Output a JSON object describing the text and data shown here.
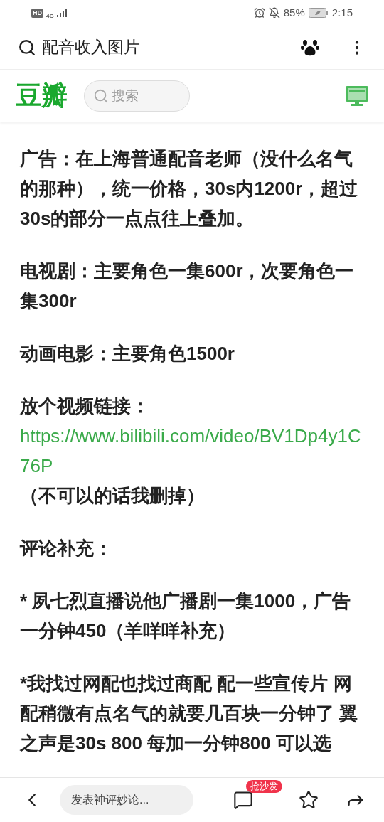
{
  "status_bar": {
    "hd": "HD",
    "network": "4G",
    "battery": "85%",
    "time": "2:15"
  },
  "browser_bar": {
    "query": "配音收入图片"
  },
  "site_header": {
    "logo": "豆瓣",
    "search_placeholder": "搜索"
  },
  "paragraphs": [
    {
      "segments": [
        {
          "kind": "text",
          "text": "广告：在上海普通配音老师（没什么名气的那种），统一价格，30s内1200r，超过30s的部分一点点往上叠加。"
        }
      ]
    },
    {
      "segments": [
        {
          "kind": "text",
          "text": "电视剧：主要角色一集600r，次要角色一集300r"
        }
      ]
    },
    {
      "segments": [
        {
          "kind": "text",
          "text": "动画电影：主要角色1500r"
        }
      ]
    },
    {
      "segments": [
        {
          "kind": "text",
          "text": "放个视频链接："
        },
        {
          "kind": "break"
        },
        {
          "kind": "link",
          "text": "https://www.bilibili.com/video/BV1Dp4y1C76P"
        },
        {
          "kind": "text",
          "text": " （不可以的话我删掉）"
        }
      ]
    },
    {
      "segments": [
        {
          "kind": "text",
          "text": "评论补充："
        }
      ]
    },
    {
      "segments": [
        {
          "kind": "text",
          "text": "* 夙七烈直播说他广播剧一集1000，广告一分钟450（羊咩咩补充）"
        }
      ]
    },
    {
      "segments": [
        {
          "kind": "text",
          "text": "*我找过网配也找过商配 配一些宣传片 网配稍微有点名气的就要几百块一分钟了 翼之声是30s 800 每加一分钟800 可以选"
        }
      ]
    }
  ],
  "bottom_bar": {
    "comment_placeholder": "发表神评妙论...",
    "comment_badge": "抢沙发"
  }
}
